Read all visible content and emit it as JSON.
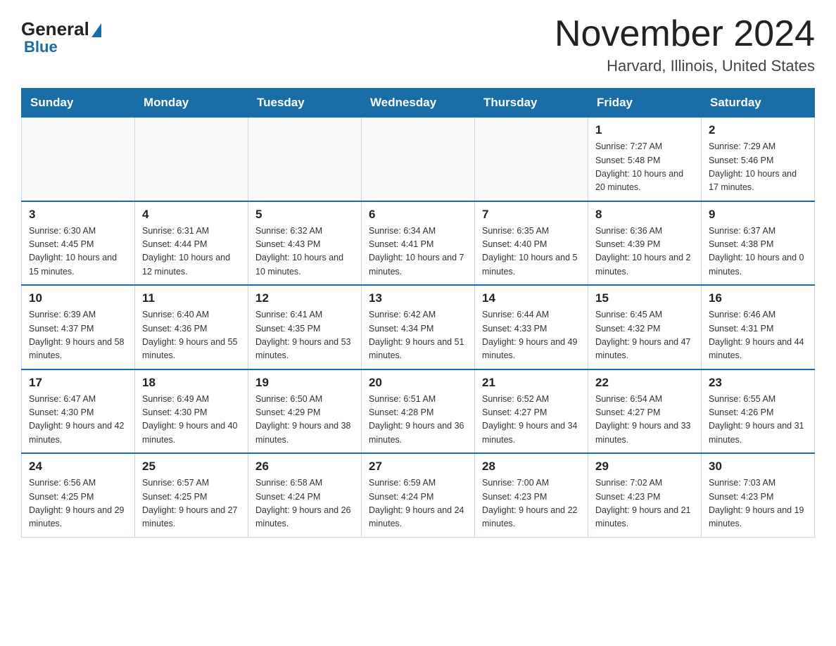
{
  "header": {
    "logo_general": "General",
    "logo_blue": "Blue",
    "month_year": "November 2024",
    "location": "Harvard, Illinois, United States"
  },
  "weekdays": [
    "Sunday",
    "Monday",
    "Tuesday",
    "Wednesday",
    "Thursday",
    "Friday",
    "Saturday"
  ],
  "weeks": [
    [
      {
        "day": "",
        "sunrise": "",
        "sunset": "",
        "daylight": ""
      },
      {
        "day": "",
        "sunrise": "",
        "sunset": "",
        "daylight": ""
      },
      {
        "day": "",
        "sunrise": "",
        "sunset": "",
        "daylight": ""
      },
      {
        "day": "",
        "sunrise": "",
        "sunset": "",
        "daylight": ""
      },
      {
        "day": "",
        "sunrise": "",
        "sunset": "",
        "daylight": ""
      },
      {
        "day": "1",
        "sunrise": "Sunrise: 7:27 AM",
        "sunset": "Sunset: 5:48 PM",
        "daylight": "Daylight: 10 hours and 20 minutes."
      },
      {
        "day": "2",
        "sunrise": "Sunrise: 7:29 AM",
        "sunset": "Sunset: 5:46 PM",
        "daylight": "Daylight: 10 hours and 17 minutes."
      }
    ],
    [
      {
        "day": "3",
        "sunrise": "Sunrise: 6:30 AM",
        "sunset": "Sunset: 4:45 PM",
        "daylight": "Daylight: 10 hours and 15 minutes."
      },
      {
        "day": "4",
        "sunrise": "Sunrise: 6:31 AM",
        "sunset": "Sunset: 4:44 PM",
        "daylight": "Daylight: 10 hours and 12 minutes."
      },
      {
        "day": "5",
        "sunrise": "Sunrise: 6:32 AM",
        "sunset": "Sunset: 4:43 PM",
        "daylight": "Daylight: 10 hours and 10 minutes."
      },
      {
        "day": "6",
        "sunrise": "Sunrise: 6:34 AM",
        "sunset": "Sunset: 4:41 PM",
        "daylight": "Daylight: 10 hours and 7 minutes."
      },
      {
        "day": "7",
        "sunrise": "Sunrise: 6:35 AM",
        "sunset": "Sunset: 4:40 PM",
        "daylight": "Daylight: 10 hours and 5 minutes."
      },
      {
        "day": "8",
        "sunrise": "Sunrise: 6:36 AM",
        "sunset": "Sunset: 4:39 PM",
        "daylight": "Daylight: 10 hours and 2 minutes."
      },
      {
        "day": "9",
        "sunrise": "Sunrise: 6:37 AM",
        "sunset": "Sunset: 4:38 PM",
        "daylight": "Daylight: 10 hours and 0 minutes."
      }
    ],
    [
      {
        "day": "10",
        "sunrise": "Sunrise: 6:39 AM",
        "sunset": "Sunset: 4:37 PM",
        "daylight": "Daylight: 9 hours and 58 minutes."
      },
      {
        "day": "11",
        "sunrise": "Sunrise: 6:40 AM",
        "sunset": "Sunset: 4:36 PM",
        "daylight": "Daylight: 9 hours and 55 minutes."
      },
      {
        "day": "12",
        "sunrise": "Sunrise: 6:41 AM",
        "sunset": "Sunset: 4:35 PM",
        "daylight": "Daylight: 9 hours and 53 minutes."
      },
      {
        "day": "13",
        "sunrise": "Sunrise: 6:42 AM",
        "sunset": "Sunset: 4:34 PM",
        "daylight": "Daylight: 9 hours and 51 minutes."
      },
      {
        "day": "14",
        "sunrise": "Sunrise: 6:44 AM",
        "sunset": "Sunset: 4:33 PM",
        "daylight": "Daylight: 9 hours and 49 minutes."
      },
      {
        "day": "15",
        "sunrise": "Sunrise: 6:45 AM",
        "sunset": "Sunset: 4:32 PM",
        "daylight": "Daylight: 9 hours and 47 minutes."
      },
      {
        "day": "16",
        "sunrise": "Sunrise: 6:46 AM",
        "sunset": "Sunset: 4:31 PM",
        "daylight": "Daylight: 9 hours and 44 minutes."
      }
    ],
    [
      {
        "day": "17",
        "sunrise": "Sunrise: 6:47 AM",
        "sunset": "Sunset: 4:30 PM",
        "daylight": "Daylight: 9 hours and 42 minutes."
      },
      {
        "day": "18",
        "sunrise": "Sunrise: 6:49 AM",
        "sunset": "Sunset: 4:30 PM",
        "daylight": "Daylight: 9 hours and 40 minutes."
      },
      {
        "day": "19",
        "sunrise": "Sunrise: 6:50 AM",
        "sunset": "Sunset: 4:29 PM",
        "daylight": "Daylight: 9 hours and 38 minutes."
      },
      {
        "day": "20",
        "sunrise": "Sunrise: 6:51 AM",
        "sunset": "Sunset: 4:28 PM",
        "daylight": "Daylight: 9 hours and 36 minutes."
      },
      {
        "day": "21",
        "sunrise": "Sunrise: 6:52 AM",
        "sunset": "Sunset: 4:27 PM",
        "daylight": "Daylight: 9 hours and 34 minutes."
      },
      {
        "day": "22",
        "sunrise": "Sunrise: 6:54 AM",
        "sunset": "Sunset: 4:27 PM",
        "daylight": "Daylight: 9 hours and 33 minutes."
      },
      {
        "day": "23",
        "sunrise": "Sunrise: 6:55 AM",
        "sunset": "Sunset: 4:26 PM",
        "daylight": "Daylight: 9 hours and 31 minutes."
      }
    ],
    [
      {
        "day": "24",
        "sunrise": "Sunrise: 6:56 AM",
        "sunset": "Sunset: 4:25 PM",
        "daylight": "Daylight: 9 hours and 29 minutes."
      },
      {
        "day": "25",
        "sunrise": "Sunrise: 6:57 AM",
        "sunset": "Sunset: 4:25 PM",
        "daylight": "Daylight: 9 hours and 27 minutes."
      },
      {
        "day": "26",
        "sunrise": "Sunrise: 6:58 AM",
        "sunset": "Sunset: 4:24 PM",
        "daylight": "Daylight: 9 hours and 26 minutes."
      },
      {
        "day": "27",
        "sunrise": "Sunrise: 6:59 AM",
        "sunset": "Sunset: 4:24 PM",
        "daylight": "Daylight: 9 hours and 24 minutes."
      },
      {
        "day": "28",
        "sunrise": "Sunrise: 7:00 AM",
        "sunset": "Sunset: 4:23 PM",
        "daylight": "Daylight: 9 hours and 22 minutes."
      },
      {
        "day": "29",
        "sunrise": "Sunrise: 7:02 AM",
        "sunset": "Sunset: 4:23 PM",
        "daylight": "Daylight: 9 hours and 21 minutes."
      },
      {
        "day": "30",
        "sunrise": "Sunrise: 7:03 AM",
        "sunset": "Sunset: 4:23 PM",
        "daylight": "Daylight: 9 hours and 19 minutes."
      }
    ]
  ]
}
